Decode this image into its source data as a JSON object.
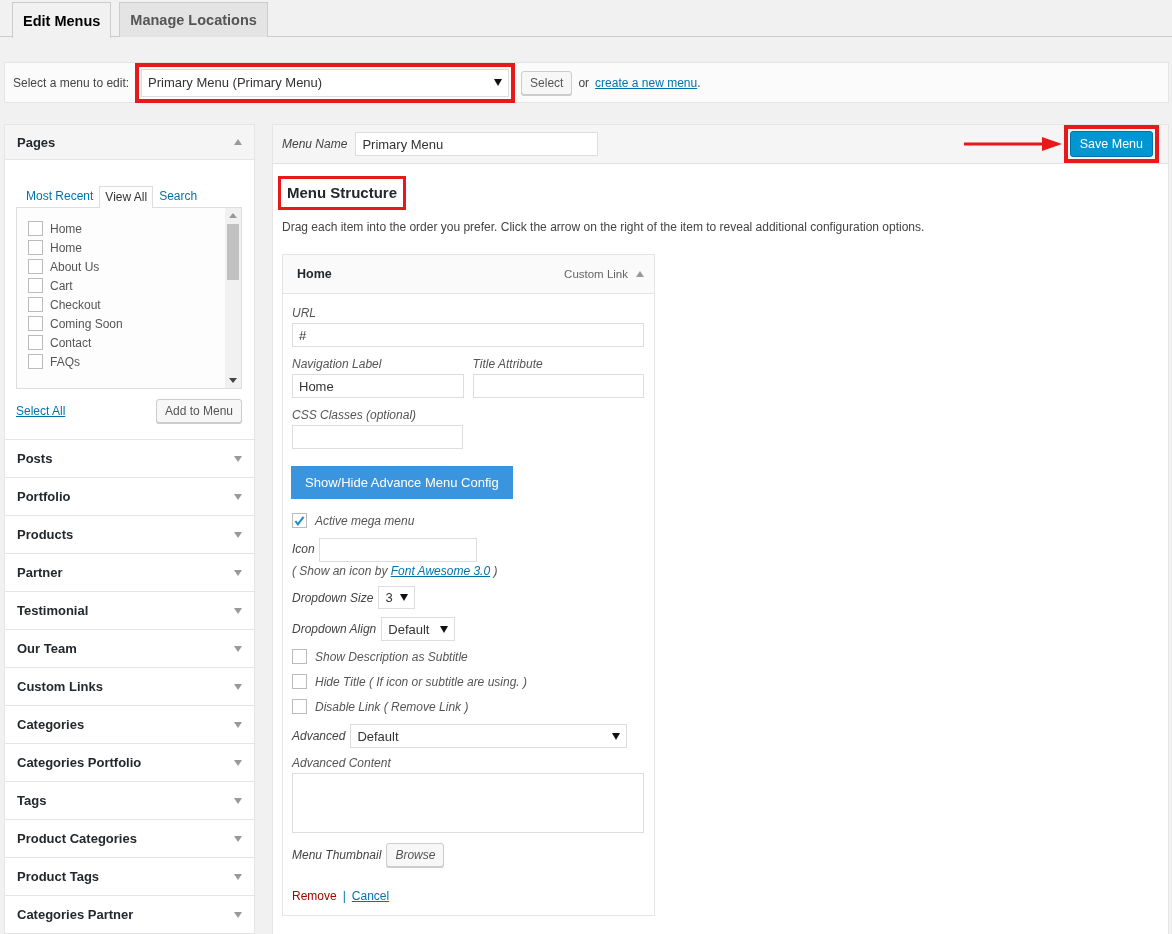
{
  "tabs": [
    {
      "label": "Edit Menus",
      "selected": true
    },
    {
      "label": "Manage Locations",
      "selected": false
    }
  ],
  "menu_select": {
    "label": "Select a menu to edit:",
    "value": "Primary Menu (Primary Menu)",
    "highlighted": true,
    "button": "Select",
    "or_text": "or",
    "create_link": "create a new menu",
    "trailing": "."
  },
  "sections": [
    {
      "title": "Pages",
      "expanded": true,
      "tabs": [
        {
          "label": "Most Recent",
          "selected": false
        },
        {
          "label": "View All",
          "selected": true
        },
        {
          "label": "Search",
          "selected": false
        }
      ],
      "items": [
        {
          "label": "Home",
          "checked": false
        },
        {
          "label": "Home",
          "checked": false
        },
        {
          "label": "About Us",
          "checked": false
        },
        {
          "label": "Cart",
          "checked": false
        },
        {
          "label": "Checkout",
          "checked": false
        },
        {
          "label": "Coming Soon",
          "checked": false
        },
        {
          "label": "Contact",
          "checked": false
        },
        {
          "label": "FAQs",
          "checked": false
        }
      ],
      "select_all": "Select All",
      "add_button": "Add to Menu"
    },
    {
      "title": "Posts",
      "expanded": false
    },
    {
      "title": "Portfolio",
      "expanded": false
    },
    {
      "title": "Products",
      "expanded": false
    },
    {
      "title": "Partner",
      "expanded": false
    },
    {
      "title": "Testimonial",
      "expanded": false
    },
    {
      "title": "Our Team",
      "expanded": false
    },
    {
      "title": "Custom Links",
      "expanded": false
    },
    {
      "title": "Categories",
      "expanded": false
    },
    {
      "title": "Categories Portfolio",
      "expanded": false
    },
    {
      "title": "Tags",
      "expanded": false
    },
    {
      "title": "Product Categories",
      "expanded": false
    },
    {
      "title": "Product Tags",
      "expanded": false
    },
    {
      "title": "Categories Partner",
      "expanded": false
    }
  ],
  "menu_name": {
    "label": "Menu Name",
    "value": "Primary Menu"
  },
  "save_button": {
    "label": "Save Menu",
    "highlighted": true
  },
  "annotation_arrow": true,
  "structure": {
    "title": "Menu Structure",
    "highlighted": true,
    "help": "Drag each item into the order you prefer. Click the arrow on the right of the item to reveal additional configuration options."
  },
  "item": {
    "title": "Home",
    "type": "Custom Link",
    "expanded": true,
    "url": {
      "label": "URL",
      "value": "#"
    },
    "nav_label": {
      "label": "Navigation Label",
      "value": "Home"
    },
    "title_attr": {
      "label": "Title Attribute"
    },
    "css_classes": {
      "label": "CSS Classes (optional)"
    },
    "advance_button": "Show/Hide Advance Menu Config",
    "mega_menu": {
      "label": "Active mega menu",
      "checked": true
    },
    "icon": {
      "label": "Icon",
      "hint_before": "( Show an icon by ",
      "link": "Font Awesome 3.0",
      "hint_after": " )"
    },
    "dropdown_size": {
      "label": "Dropdown Size",
      "value": "3"
    },
    "dropdown_align": {
      "label": "Dropdown Align",
      "value": "Default"
    },
    "options": [
      {
        "label": "Show Description as Subtitle",
        "checked": false
      },
      {
        "label": "Hide Title ( If icon or subtitle are using. )",
        "checked": false
      },
      {
        "label": "Disable Link ( Remove Link )",
        "checked": false
      }
    ],
    "advanced": {
      "label": "Advanced",
      "value": "Default"
    },
    "advanced_content": {
      "label": "Advanced Content"
    },
    "thumbnail": {
      "label": "Menu Thumbnail",
      "button": "Browse"
    },
    "remove": "Remove",
    "separator": "|",
    "cancel": "Cancel"
  }
}
